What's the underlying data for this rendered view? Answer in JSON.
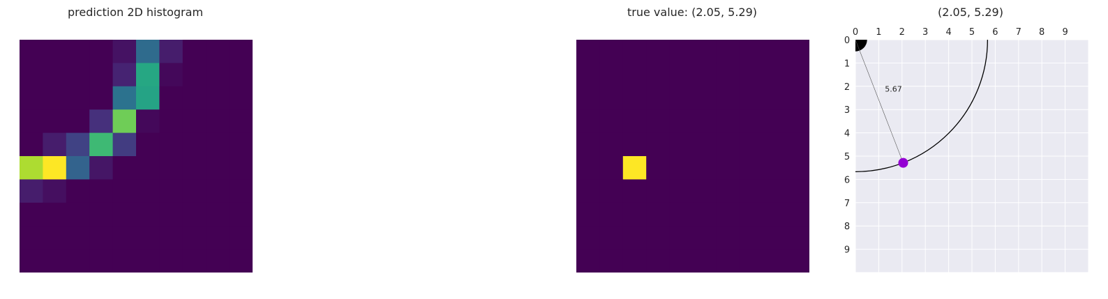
{
  "chart_data": [
    {
      "type": "heatmap",
      "title": "prediction 2D histogram",
      "rows": 10,
      "cols": 10,
      "colormap": "viridis",
      "axes_visible": false,
      "values": [
        [
          0,
          0,
          0,
          0,
          0.05,
          0.35,
          0.08,
          0,
          0,
          0
        ],
        [
          0,
          0,
          0,
          0,
          0.1,
          0.6,
          0.02,
          0,
          0,
          0
        ],
        [
          0,
          0,
          0,
          0,
          0.38,
          0.58,
          0,
          0,
          0,
          0
        ],
        [
          0,
          0,
          0,
          0.14,
          0.78,
          0.02,
          0,
          0,
          0,
          0
        ],
        [
          0,
          0.08,
          0.2,
          0.68,
          0.18,
          0,
          0,
          0,
          0,
          0
        ],
        [
          0.88,
          1.0,
          0.32,
          0.06,
          0,
          0,
          0,
          0,
          0,
          0
        ],
        [
          0.08,
          0.04,
          0,
          0,
          0,
          0,
          0,
          0,
          0,
          0
        ],
        [
          0,
          0,
          0,
          0,
          0,
          0,
          0,
          0,
          0,
          0
        ],
        [
          0,
          0,
          0,
          0,
          0,
          0,
          0,
          0,
          0,
          0
        ],
        [
          0,
          0,
          0,
          0,
          0,
          0,
          0,
          0,
          0,
          0
        ]
      ]
    },
    {
      "type": "heatmap",
      "title": "true value: (2.05, 5.29)",
      "rows": 10,
      "cols": 10,
      "colormap": "viridis",
      "axes_visible": false,
      "hot_cells": [
        {
          "row": 5,
          "col": 2,
          "value": 1
        }
      ]
    },
    {
      "type": "scatter",
      "title": "(2.05, 5.29)",
      "xlim": [
        0,
        10
      ],
      "ylim": [
        10,
        0
      ],
      "xticks": [
        0,
        1,
        2,
        3,
        4,
        5,
        6,
        7,
        8,
        9
      ],
      "yticks": [
        0,
        1,
        2,
        3,
        4,
        5,
        6,
        7,
        8,
        9
      ],
      "x_tick_position": "top",
      "grid": true,
      "background": "#eaeaf2",
      "point": {
        "x": 2.05,
        "y": 5.29,
        "color": "#9400d3"
      },
      "origin_marker": {
        "x": 0,
        "y": 0,
        "radius": 0.5,
        "color": "#000000"
      },
      "arc_radius": 5.67,
      "distance_label": "5.67"
    }
  ]
}
